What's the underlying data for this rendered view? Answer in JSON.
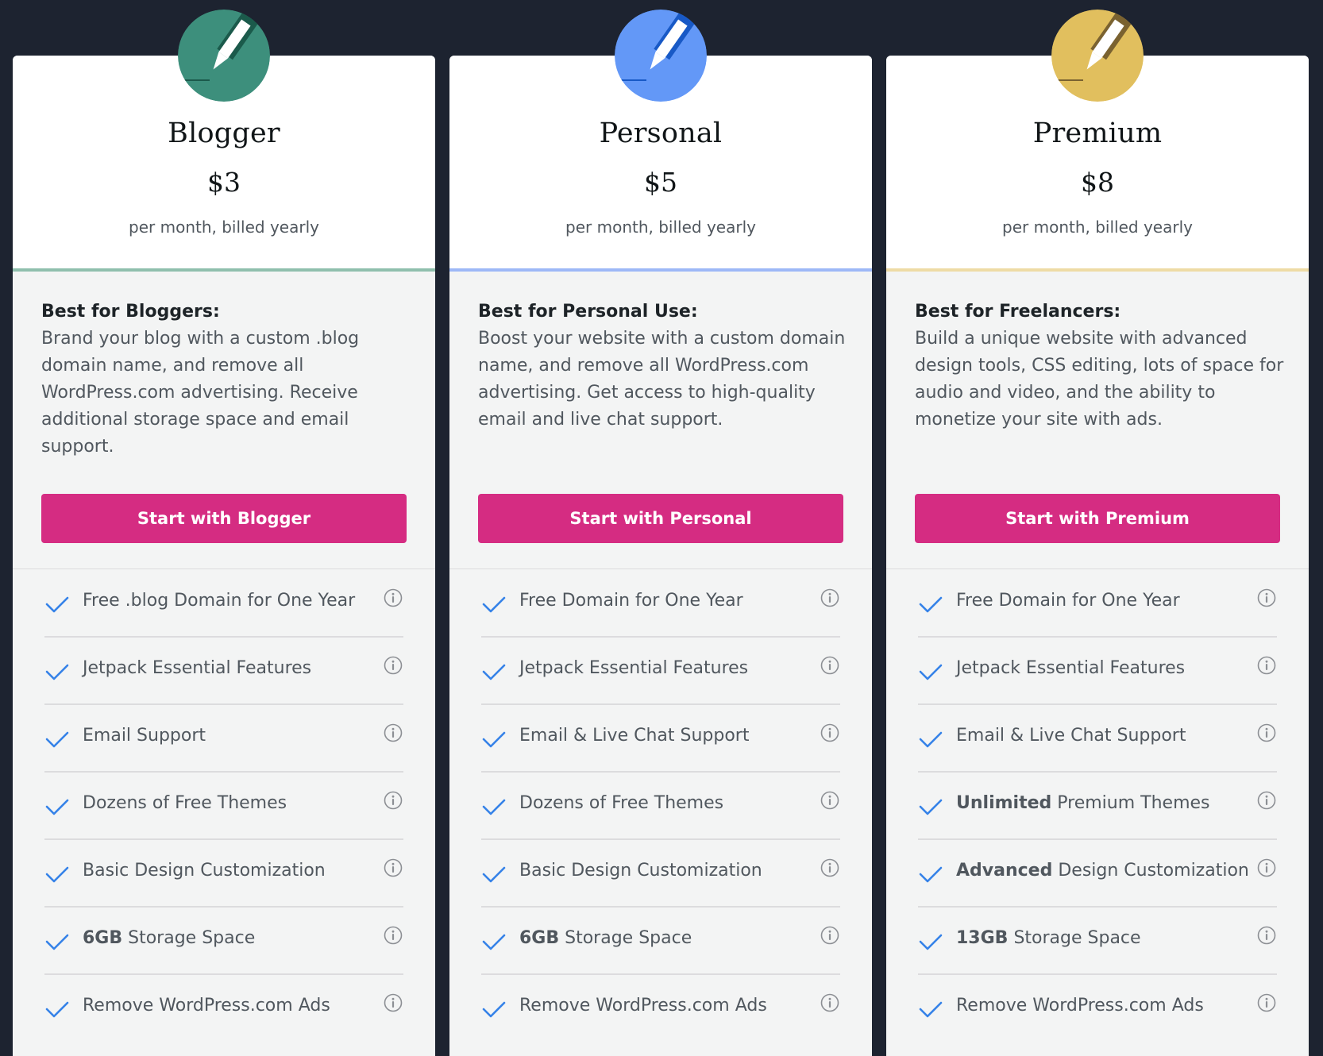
{
  "colors": {
    "background": "#1d2330",
    "cta": "#d52c82",
    "check": "#3582e8"
  },
  "plans": [
    {
      "name": "Blogger",
      "price": "$3",
      "billing": "per month, billed yearly",
      "icon": "pencil-icon",
      "icon_color": "#3d8f7c",
      "icon_dark": "#1b5a4b",
      "accent_color": "#8fbfad",
      "best_for_title": "Best for Bloggers:",
      "description": "Brand your blog with a custom .blog domain name, and remove all WordPress.com advertising. Receive additional storage space and email support.",
      "cta": "Start with Blogger",
      "features": [
        {
          "bold": "",
          "text": "Free .blog Domain for One Year"
        },
        {
          "bold": "",
          "text": "Jetpack Essential Features"
        },
        {
          "bold": "",
          "text": "Email Support"
        },
        {
          "bold": "",
          "text": "Dozens of Free Themes"
        },
        {
          "bold": "",
          "text": "Basic Design Customization"
        },
        {
          "bold": "6GB",
          "text": " Storage Space"
        },
        {
          "bold": "",
          "text": "Remove WordPress.com Ads"
        }
      ]
    },
    {
      "name": "Personal",
      "price": "$5",
      "billing": "per month, billed yearly",
      "icon": "pencil-icon",
      "icon_color": "#6398f7",
      "icon_dark": "#1859c6",
      "accent_color": "#9db8f7",
      "best_for_title": "Best for Personal Use:",
      "description": "Boost your website with a custom domain name, and remove all WordPress.com advertising. Get access to high-quality email and live chat support.",
      "cta": "Start with Personal",
      "features": [
        {
          "bold": "",
          "text": "Free Domain for One Year"
        },
        {
          "bold": "",
          "text": "Jetpack Essential Features"
        },
        {
          "bold": "",
          "text": "Email & Live Chat Support"
        },
        {
          "bold": "",
          "text": "Dozens of Free Themes"
        },
        {
          "bold": "",
          "text": "Basic Design Customization"
        },
        {
          "bold": "6GB",
          "text": " Storage Space"
        },
        {
          "bold": "",
          "text": "Remove WordPress.com Ads"
        }
      ]
    },
    {
      "name": "Premium",
      "price": "$8",
      "billing": "per month, billed yearly",
      "icon": "pencil-icon",
      "icon_color": "#e1bf5e",
      "icon_dark": "#7a6230",
      "accent_color": "#eedba5",
      "best_for_title": "Best for Freelancers:",
      "description": "Build a unique website with advanced design tools, CSS editing, lots of space for audio and video, and the ability to monetize your site with ads.",
      "cta": "Start with Premium",
      "features": [
        {
          "bold": "",
          "text": "Free Domain for One Year"
        },
        {
          "bold": "",
          "text": "Jetpack Essential Features"
        },
        {
          "bold": "",
          "text": "Email & Live Chat Support"
        },
        {
          "bold": "Unlimited",
          "text": " Premium Themes"
        },
        {
          "bold": "Advanced",
          "text": " Design Customization"
        },
        {
          "bold": "13GB",
          "text": " Storage Space"
        },
        {
          "bold": "",
          "text": "Remove WordPress.com Ads"
        }
      ]
    }
  ]
}
